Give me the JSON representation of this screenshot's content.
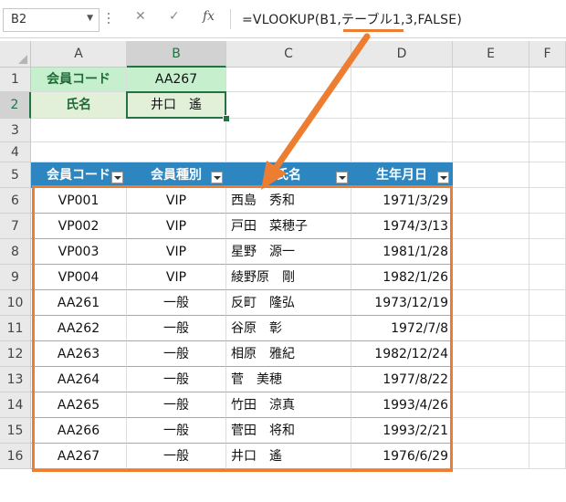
{
  "formula_bar": {
    "name_box": "B2",
    "cancel_glyph": "✕",
    "confirm_glyph": "✓",
    "function_glyph": "fx",
    "formula": "=VLOOKUP(B1,テーブル1,3,FALSE)"
  },
  "columns": [
    "A",
    "B",
    "C",
    "D",
    "E",
    "F"
  ],
  "rows": [
    "1",
    "2",
    "3",
    "4",
    "5",
    "6",
    "7",
    "8",
    "9",
    "10",
    "11",
    "12",
    "13",
    "14",
    "15",
    "16"
  ],
  "lookup": {
    "label_code": "会員コード",
    "value_code": "AA267",
    "label_name": "氏名",
    "value_name": "井口　遙"
  },
  "table": {
    "headers": [
      "会員コード",
      "会員種別",
      "氏名",
      "生年月日"
    ],
    "rows": [
      [
        "VP001",
        "VIP",
        "西島　秀和",
        "1971/3/29"
      ],
      [
        "VP002",
        "VIP",
        "戸田　菜穂子",
        "1974/3/13"
      ],
      [
        "VP003",
        "VIP",
        "星野　源一",
        "1981/1/28"
      ],
      [
        "VP004",
        "VIP",
        "綾野原　剛",
        "1982/1/26"
      ],
      [
        "AA261",
        "一般",
        "反町　隆弘",
        "1973/12/19"
      ],
      [
        "AA262",
        "一般",
        "谷原　彰",
        "1972/7/8"
      ],
      [
        "AA263",
        "一般",
        "相原　雅紀",
        "1982/12/24"
      ],
      [
        "AA264",
        "一般",
        "菅　美穂",
        "1977/8/22"
      ],
      [
        "AA265",
        "一般",
        "竹田　涼真",
        "1993/4/26"
      ],
      [
        "AA266",
        "一般",
        "菅田　将和",
        "1993/2/21"
      ],
      [
        "AA267",
        "一般",
        "井口　遙",
        "1976/6/29"
      ]
    ]
  },
  "colors": {
    "accent_orange": "#ed7d31",
    "table_header_blue": "#2e86c1",
    "label_green": "#c6efce",
    "excel_green": "#217346"
  }
}
